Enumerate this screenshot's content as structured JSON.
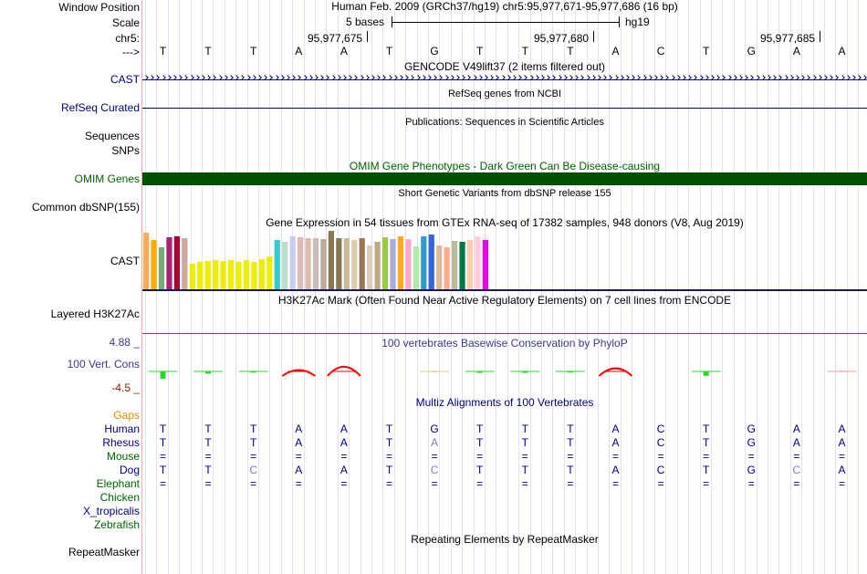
{
  "labels": {
    "window_position": "Window Position",
    "scale": "Scale",
    "chrom": "chr5:",
    "strand": "--->",
    "cast_gencode": "CAST",
    "refseq": "RefSeq Curated",
    "sequences": "Sequences",
    "snps": "SNPs",
    "omim": "OMIM Genes",
    "dbsnp": "Common dbSNP(155)",
    "cast_gtex": "CAST",
    "h3k27ac": "Layered H3K27Ac",
    "cons_max": "4.88 _",
    "cons": "100 Vert. Cons",
    "cons_min": "-4.5 _",
    "gaps": "Gaps",
    "repeatmasker": "RepeatMasker"
  },
  "header": {
    "position_text": "Human Feb. 2009 (GRCh37/hg19)   chr5:95,977,671-95,977,686 (16 bp)",
    "scale_label": "5 bases",
    "assembly": "hg19",
    "ticks": [
      "95,977,675",
      "95,977,680",
      "95,977,685"
    ]
  },
  "sequence": [
    "T",
    "T",
    "T",
    "A",
    "A",
    "T",
    "G",
    "T",
    "T",
    "T",
    "A",
    "C",
    "T",
    "G",
    "A",
    "A"
  ],
  "tracks": {
    "gencode_title": "GENCODE V49lift37 (2 items filtered out)",
    "refseq_title": "RefSeq genes from NCBI",
    "publications_title": "Publications: Sequences in Scientific Articles",
    "omim_title": "OMIM Gene Phenotypes - Dark Green Can Be Disease-causing",
    "dbsnp_title": "Short Genetic Variants from dbSNP release 155",
    "gtex_title": "Gene Expression in 54 tissues from GTEx RNA-seq of 17382 samples, 948 donors (V8, Aug 2019)",
    "h3k27ac_title": "H3K27Ac Mark (Often Found Near Active Regulatory Elements) on 7 cell lines from ENCODE",
    "phylop_title": "100 vertebrates Basewise Conservation by PhyloP",
    "multiz_title": "Multiz Alignments of 100 Vertebrates",
    "repeatmasker_title": "Repeating Elements by RepeatMasker"
  },
  "gtex_bars": [
    {
      "v": 62,
      "c": "#ffaa55"
    },
    {
      "v": 54,
      "c": "#ffaa00"
    },
    {
      "v": 46,
      "c": "#77aa77"
    },
    {
      "v": 57,
      "c": "#aa2277"
    },
    {
      "v": 58,
      "c": "#aa0033"
    },
    {
      "v": 56,
      "c": "#ccaa99"
    },
    {
      "v": 28,
      "c": "#eeee00"
    },
    {
      "v": 30,
      "c": "#eeee00"
    },
    {
      "v": 31,
      "c": "#eeee00"
    },
    {
      "v": 32,
      "c": "#eeee00"
    },
    {
      "v": 31,
      "c": "#eeee00"
    },
    {
      "v": 32,
      "c": "#eeee00"
    },
    {
      "v": 30,
      "c": "#eeee00"
    },
    {
      "v": 32,
      "c": "#eeee00"
    },
    {
      "v": 30,
      "c": "#eeee00"
    },
    {
      "v": 33,
      "c": "#eeee00"
    },
    {
      "v": 36,
      "c": "#eeee00"
    },
    {
      "v": 54,
      "c": "#33cccc"
    },
    {
      "v": 52,
      "c": "#bbddcc"
    },
    {
      "v": 58,
      "c": "#ccccee"
    },
    {
      "v": 57,
      "c": "#ddbbbb"
    },
    {
      "v": 56,
      "c": "#ddbbaa"
    },
    {
      "v": 56,
      "c": "#ccbbbb"
    },
    {
      "v": 55,
      "c": "#bbaa99"
    },
    {
      "v": 64,
      "c": "#887755"
    },
    {
      "v": 56,
      "c": "#887755"
    },
    {
      "v": 56,
      "c": "#ccbb99"
    },
    {
      "v": 54,
      "c": "#ddccaa"
    },
    {
      "v": 56,
      "c": "#997755"
    },
    {
      "v": 48,
      "c": "#ddccbb"
    },
    {
      "v": 52,
      "c": "#bbaa88"
    },
    {
      "v": 57,
      "c": "#99cc44"
    },
    {
      "v": 55,
      "c": "#aaaadd"
    },
    {
      "v": 58,
      "c": "#ffaa22"
    },
    {
      "v": 55,
      "c": "#ffaacc"
    },
    {
      "v": 47,
      "c": "#aaeeaa"
    },
    {
      "v": 58,
      "c": "#3399cc"
    },
    {
      "v": 60,
      "c": "#3366dd"
    },
    {
      "v": 48,
      "c": "#ddbb99"
    },
    {
      "v": 46,
      "c": "#ffaa88"
    },
    {
      "v": 53,
      "c": "#bbbb99"
    },
    {
      "v": 52,
      "c": "#007744"
    },
    {
      "v": 54,
      "c": "#ffccaa"
    },
    {
      "v": 58,
      "c": "#ffccdd"
    },
    {
      "v": 54,
      "c": "#ee00ee"
    }
  ],
  "phylop": [
    {
      "pos": 0,
      "v": -0.5,
      "c": "#22dd22"
    },
    {
      "pos": 1,
      "v": -0.15,
      "c": "#22dd22"
    },
    {
      "pos": 2,
      "v": -0.08,
      "c": "#22dd22"
    },
    {
      "pos": 3,
      "v": 0.5,
      "c": "#ff0000"
    },
    {
      "pos": 4,
      "v": 0.9,
      "c": "#ff0000"
    },
    {
      "pos": 6,
      "v": -0.06,
      "c": "#ddcc88"
    },
    {
      "pos": 7,
      "v": -0.1,
      "c": "#22dd22"
    },
    {
      "pos": 8,
      "v": -0.1,
      "c": "#22dd22"
    },
    {
      "pos": 9,
      "v": -0.08,
      "c": "#22dd22"
    },
    {
      "pos": 10,
      "v": 0.7,
      "c": "#ff0000"
    },
    {
      "pos": 12,
      "v": -0.3,
      "c": "#22dd22"
    },
    {
      "pos": 15,
      "v": 0.05,
      "c": "#ff9999"
    }
  ],
  "multiz": {
    "species": [
      {
        "name": "Human",
        "color": "#000080"
      },
      {
        "name": "Rhesus",
        "color": "#000080"
      },
      {
        "name": "Mouse",
        "color": "#006400"
      },
      {
        "name": "Dog",
        "color": "#000080"
      },
      {
        "name": "Elephant",
        "color": "#006400"
      },
      {
        "name": "Chicken",
        "color": "#006400"
      },
      {
        "name": "X_tropicalis",
        "color": "#000080"
      },
      {
        "name": "Zebrafish",
        "color": "#006400"
      }
    ],
    "rows": [
      [
        "T",
        "T",
        "T",
        "A",
        "A",
        "T",
        "G",
        "T",
        "T",
        "T",
        "A",
        "C",
        "T",
        "G",
        "A",
        "A"
      ],
      [
        "T",
        "T",
        "T",
        "A",
        "A",
        "T",
        "A",
        "T",
        "T",
        "T",
        "A",
        "C",
        "T",
        "G",
        "A",
        "A"
      ],
      [
        "=",
        "=",
        "=",
        "=",
        "=",
        "=",
        "=",
        "=",
        "=",
        "=",
        "=",
        "=",
        "=",
        "=",
        "=",
        "="
      ],
      [
        "T",
        "T",
        "C",
        "A",
        "A",
        "T",
        "C",
        "T",
        "T",
        "T",
        "A",
        "C",
        "T",
        "G",
        "C",
        "A"
      ],
      [
        "=",
        "=",
        "=",
        "=",
        "=",
        "=",
        "=",
        "=",
        "=",
        "=",
        "=",
        "=",
        "=",
        "=",
        "=",
        "="
      ],
      [],
      [],
      []
    ],
    "mismatch": [
      [],
      [
        6
      ],
      [],
      [
        2,
        6,
        14
      ],
      [],
      [],
      [],
      []
    ]
  },
  "colors": {
    "navy": "#000080",
    "gencode_line": "#0c0c78",
    "omim_bar": "#005000",
    "omim_text": "#006400",
    "gaps": "#e58a00",
    "phylop_text": "#3a3a8a",
    "cons_min": "#8b2200",
    "mismatch": "#7c7cc8"
  }
}
